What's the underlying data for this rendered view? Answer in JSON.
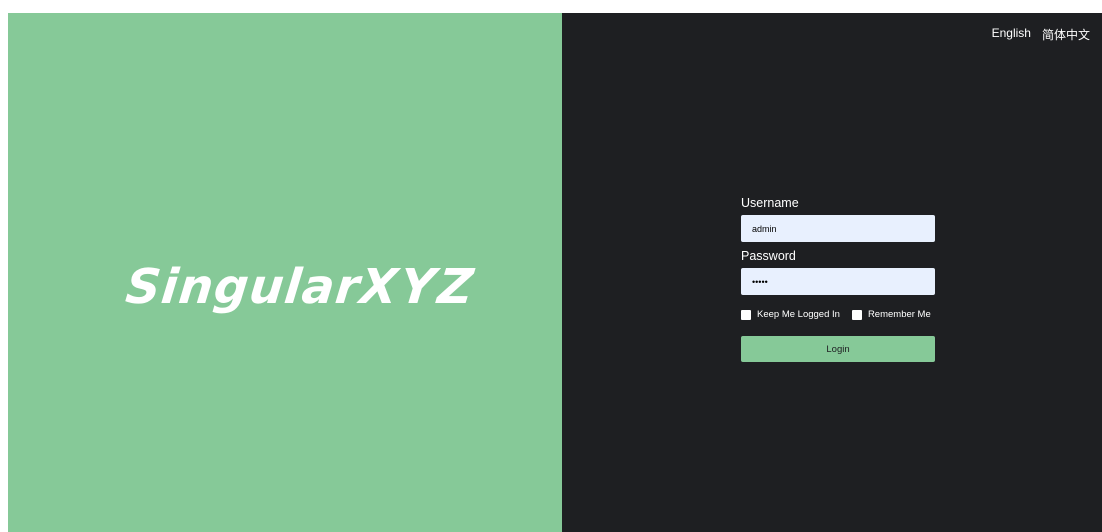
{
  "brand": {
    "logo_part1": "Singular",
    "logo_part2": "XYZ"
  },
  "language_switch": {
    "english": "English",
    "chinese": "简体中文"
  },
  "login_form": {
    "username_label": "Username",
    "username_value": "admin",
    "password_label": "Password",
    "password_value": "•••••",
    "keep_logged_in_label": "Keep Me Logged In",
    "keep_logged_in_checked": false,
    "remember_me_label": "Remember Me",
    "remember_me_checked": false,
    "login_button_label": "Login"
  },
  "colors": {
    "left_panel": "#86c998",
    "right_panel": "#1e1f22",
    "input_background": "#e8f0fe",
    "button": "#86c998"
  }
}
